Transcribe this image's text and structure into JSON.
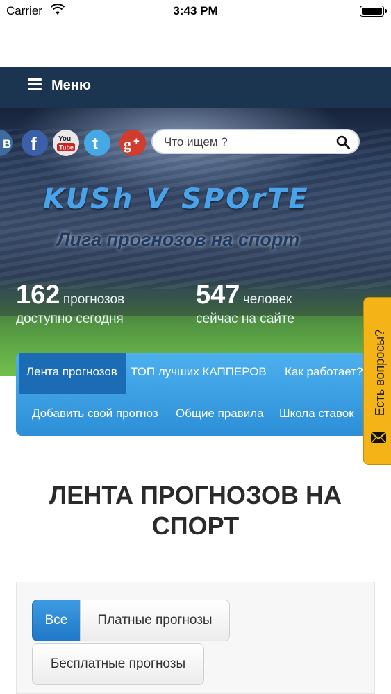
{
  "status_bar": {
    "carrier": "Carrier",
    "time": "3:43 PM"
  },
  "menu": {
    "label": "Меню"
  },
  "social": [
    "vk-icon",
    "facebook-icon",
    "youtube-icon",
    "twitter-icon",
    "google-plus-icon"
  ],
  "search": {
    "placeholder": "Что ищем ?"
  },
  "hero": {
    "logo": "KUSh V SPOrTE",
    "tagline": "Лига прогнозов на спорт",
    "stats": [
      {
        "number": "162",
        "unit": "прогнозов",
        "sub": "доступно сегодня"
      },
      {
        "number": "547",
        "unit": "человек",
        "sub": "сейчас на сайте"
      }
    ]
  },
  "nav": {
    "items": [
      "Лента прогнозов",
      "ТОП лучших КАППЕРОВ",
      "Как работает?",
      "Добавить свой прогноз",
      "Общие правила",
      "Школа ставок"
    ]
  },
  "questions_tab": {
    "label": "Есть вопросы?"
  },
  "page": {
    "title": "ЛЕНТА ПРОГНОЗОВ НА СПОРТ"
  },
  "filters": [
    "Все",
    "Платные прогнозы",
    "Бесплатные прогнозы"
  ],
  "colors": {
    "menu_bg": "#1b3550",
    "nav_blue": "#2c8fd8",
    "active_blue": "#1b6bb5",
    "tab_orange": "#f4b316"
  }
}
